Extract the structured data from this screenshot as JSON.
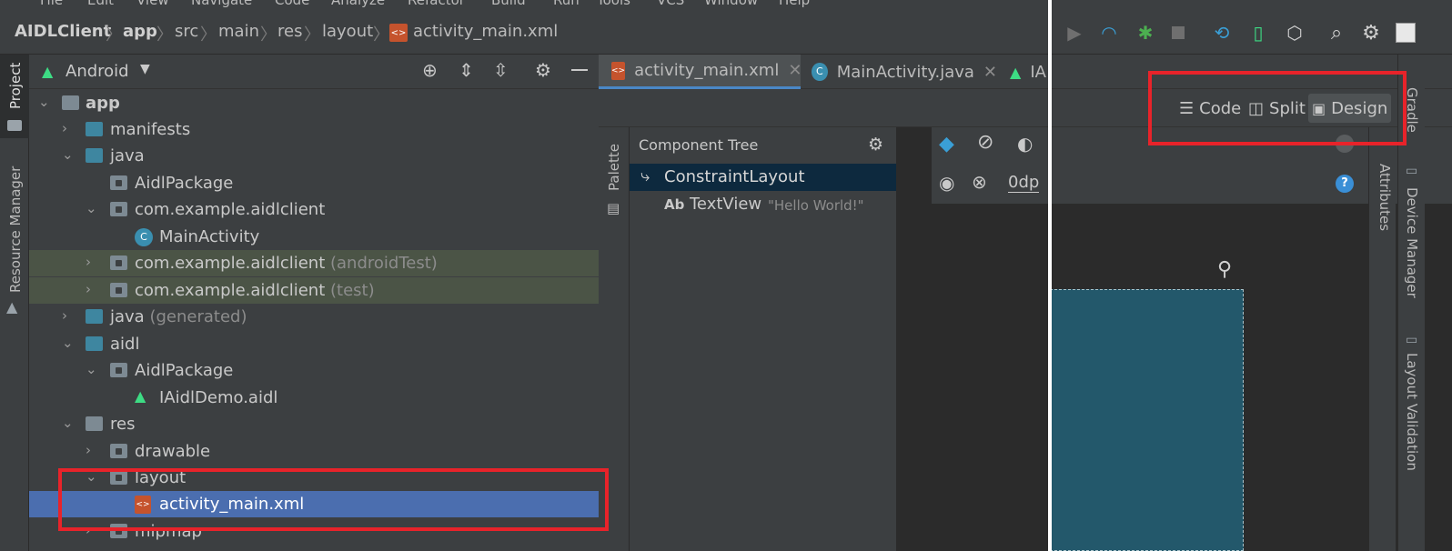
{
  "menu": [
    "File",
    "Edit",
    "View",
    "Navigate",
    "Code",
    "Analyze",
    "Refactor",
    "Build",
    "Run",
    "Tools",
    "VCS",
    "Window",
    "Help"
  ],
  "breadcrumb": [
    "AIDLClient",
    "app",
    "src",
    "main",
    "res",
    "layout",
    "activity_main.xml"
  ],
  "project_panel": {
    "view_selector": "Android",
    "tree": [
      {
        "label": "app",
        "extra": ""
      },
      {
        "label": "manifests",
        "extra": ""
      },
      {
        "label": "java",
        "extra": ""
      },
      {
        "label": "AidlPackage",
        "extra": ""
      },
      {
        "label": "com.example.aidlclient",
        "extra": ""
      },
      {
        "label": "MainActivity",
        "extra": ""
      },
      {
        "label": "com.example.aidlclient",
        "extra": "(androidTest)"
      },
      {
        "label": "com.example.aidlclient",
        "extra": "(test)"
      },
      {
        "label": "java",
        "extra": "(generated)"
      },
      {
        "label": "aidl",
        "extra": ""
      },
      {
        "label": "AidlPackage",
        "extra": ""
      },
      {
        "label": "IAidlDemo.aidl",
        "extra": ""
      },
      {
        "label": "res",
        "extra": ""
      },
      {
        "label": "drawable",
        "extra": ""
      },
      {
        "label": "layout",
        "extra": ""
      },
      {
        "label": "activity_main.xml",
        "extra": ""
      },
      {
        "label": "mipmap",
        "extra": ""
      }
    ]
  },
  "left_strip": {
    "project": "Project",
    "resource_manager": "Resource Manager"
  },
  "editor_tabs": [
    "activity_main.xml",
    "MainActivity.java",
    "IA"
  ],
  "view_modes": {
    "code": "Code",
    "split": "Split",
    "design": "Design"
  },
  "palette_label": "Palette",
  "component_tree": {
    "title": "Component Tree",
    "root": "ConstraintLayout",
    "child": "TextView",
    "child_prefix": "Ab",
    "child_value": "\"Hello World!\""
  },
  "design_tools": {
    "margin": "0dp"
  },
  "right_strip": {
    "gradle": "Gradle",
    "device_manager": "Device Manager",
    "layout_validation": "Layout Validation",
    "attributes": "Attributes"
  },
  "colors": {
    "highlight": "#e8232a",
    "selection": "#4b6eaf",
    "android_green": "#3ddc84"
  }
}
